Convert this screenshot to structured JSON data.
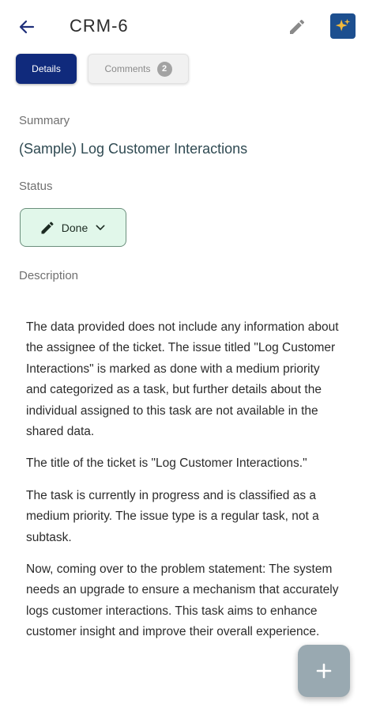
{
  "header": {
    "title": "CRM-6",
    "back_icon": "arrow-left-icon",
    "edit_icon": "pencil-icon",
    "ai_icon": "sparkle-assistant-icon",
    "accent": "#1d4f8f"
  },
  "tabs": [
    {
      "label": "Details",
      "active": true
    },
    {
      "label": "Comments",
      "count": "2",
      "active": false
    }
  ],
  "fields": {
    "summary_label": "Summary",
    "summary_value": "(Sample) Log Customer Interactions",
    "status_label": "Status",
    "status_value": "Done",
    "status_color": "#e1f7ea",
    "description_label": "Description"
  },
  "description_paragraphs": [
    "The data provided does not include any information about the assignee of the ticket. The issue titled \"Log Customer Interactions\" is marked as done with a medium priority and categorized as a task, but further details about the individual assigned to this task are not available in the shared data.",
    "The title of the ticket is \"Log Customer Interactions.\"",
    "The task is currently in progress and is classified as a medium priority. The issue type is a regular task, not a subtask.",
    "Now, coming over to the problem statement: The system needs an upgrade to ensure a mechanism that accurately logs customer interactions. This task aims to enhance customer insight and improve their overall experience."
  ],
  "fab": {
    "icon": "plus-icon"
  }
}
